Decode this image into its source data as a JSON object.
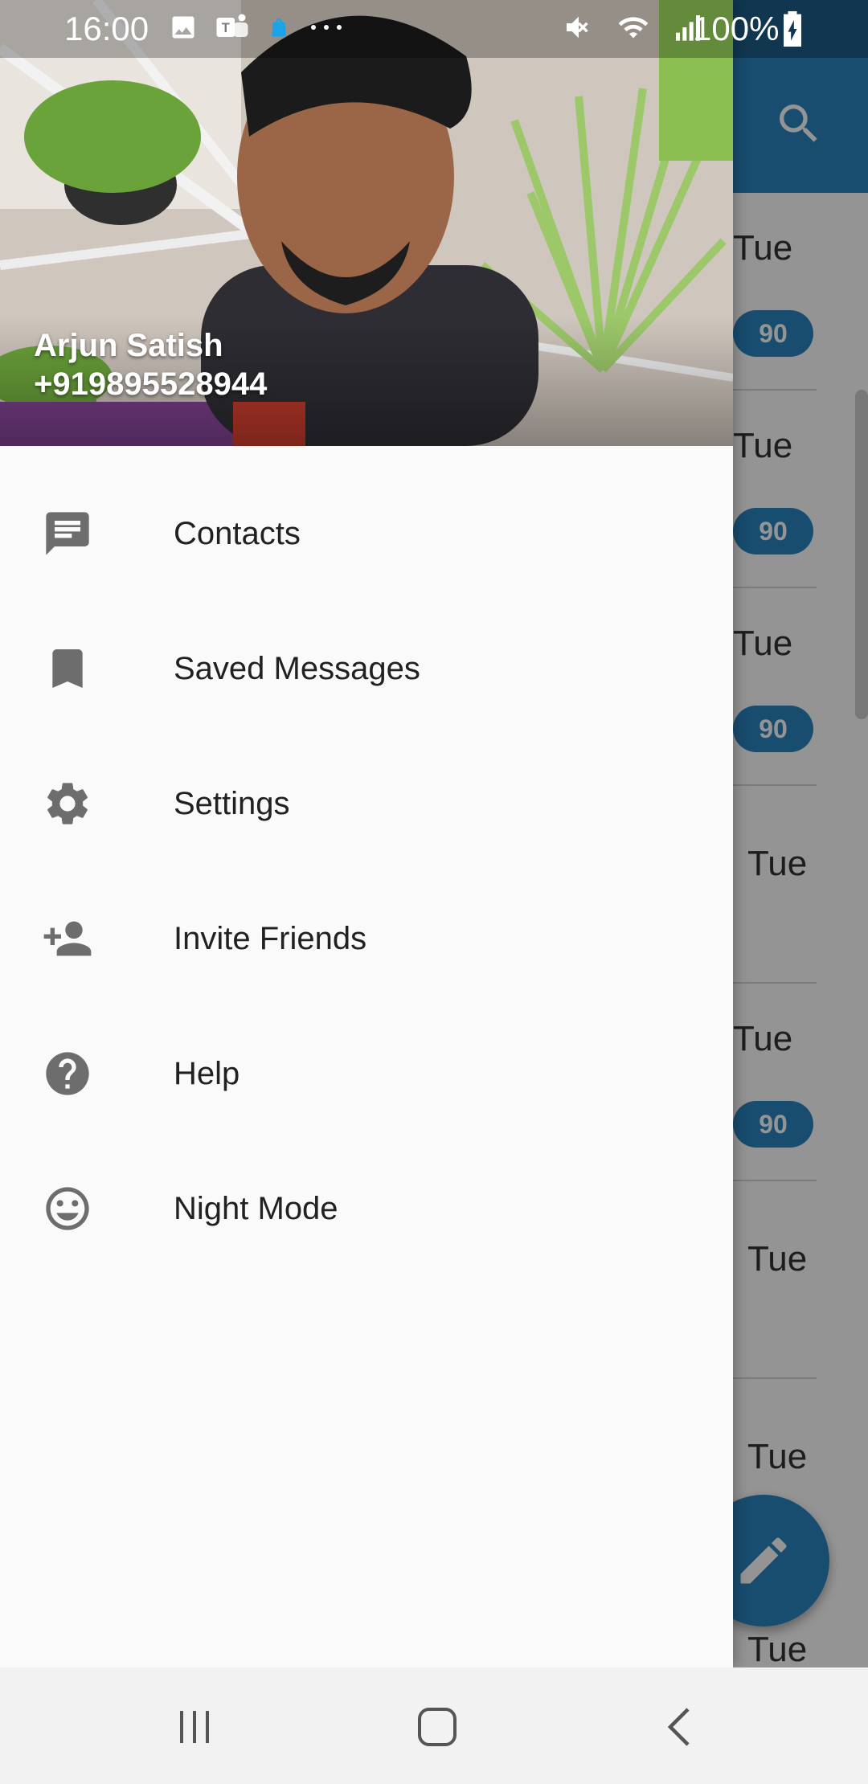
{
  "status_bar": {
    "time": "16:00",
    "battery": "100%",
    "left_icons": [
      "image-icon",
      "teams-icon",
      "shopping-bag-icon",
      "more-dots-icon"
    ],
    "right_icons": [
      "mute-icon",
      "wifi-icon",
      "signal-icon",
      "battery-charging-icon"
    ]
  },
  "drawer": {
    "header": {
      "name": "Arjun Satish",
      "phone": "+919895528944"
    },
    "items": [
      {
        "label": "Contacts",
        "icon": "chat-icon"
      },
      {
        "label": "Saved Messages",
        "icon": "bookmark-icon"
      },
      {
        "label": "Settings",
        "icon": "gear-icon"
      },
      {
        "label": "Invite Friends",
        "icon": "add-person-icon"
      },
      {
        "label": "Help",
        "icon": "help-icon"
      },
      {
        "label": "Night Mode",
        "icon": "smiley-icon"
      }
    ]
  },
  "background_list": {
    "rows": [
      {
        "day": "Tue",
        "badge": "90"
      },
      {
        "day": "Tue",
        "badge": "90"
      },
      {
        "day": "Tue",
        "badge": "90"
      },
      {
        "day": "Tue",
        "badge": ""
      },
      {
        "day": "Tue",
        "badge": "90"
      },
      {
        "day": "Tue",
        "badge": ""
      },
      {
        "day": "Tue",
        "badge": ""
      },
      {
        "day": "Tue",
        "badge": ""
      }
    ]
  },
  "colors": {
    "accent": "#2a86c0",
    "menu_icon": "#6d6d6d",
    "drawer_bg": "#fafafa"
  },
  "navigation_bar": {
    "buttons": [
      "recent-apps-icon",
      "home-icon",
      "back-icon"
    ]
  }
}
